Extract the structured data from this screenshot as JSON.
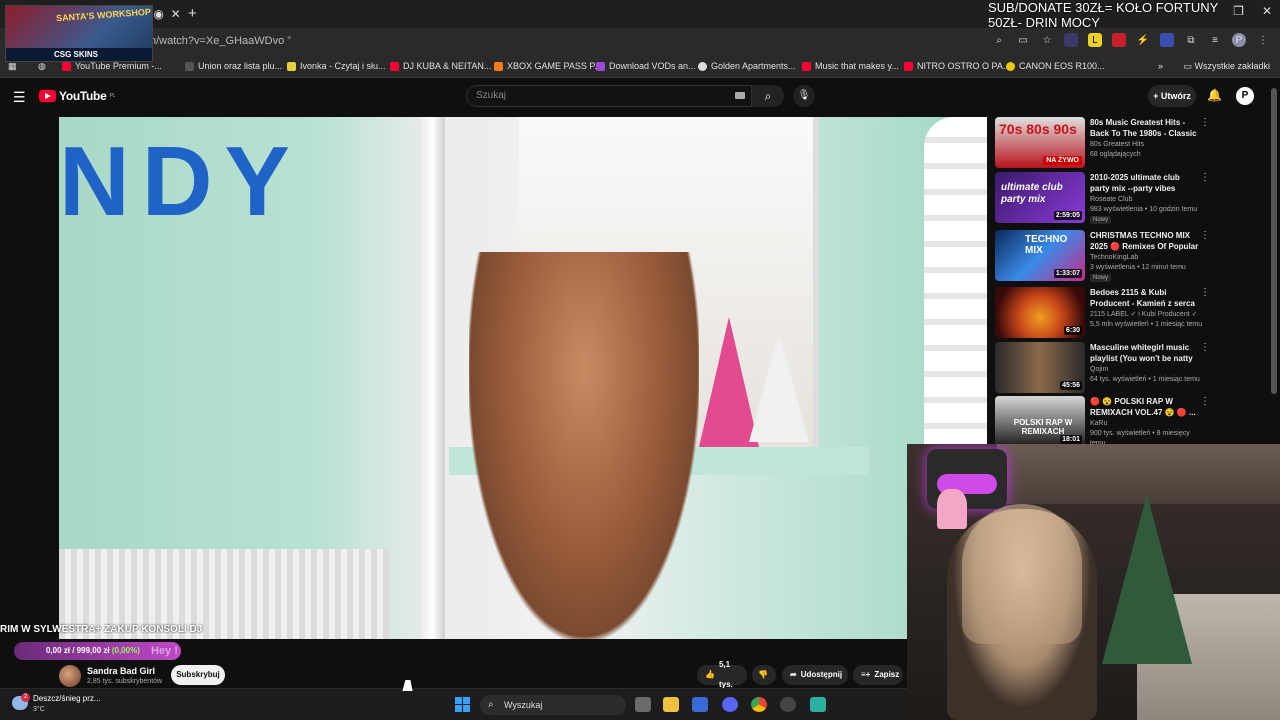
{
  "browser": {
    "url": "n/watch?v=Xe_GHaaWDvo",
    "bookmarks": [
      {
        "label": "YouTube Premium -...",
        "color": "#ff0033"
      },
      {
        "label": "Union oraz lista plu...",
        "color": "#555555"
      },
      {
        "label": "Ivonka - Czytaj i słu...",
        "color": "#e8d23c"
      },
      {
        "label": "DJ KUBA & NEITAN...",
        "color": "#ff0033"
      },
      {
        "label": "XBOX GAME PASS P...",
        "color": "#ff7a1a"
      },
      {
        "label": "Download VODs an...",
        "color": "#9b4ad8"
      },
      {
        "label": "Golden Apartments...",
        "color": "#dddddd"
      },
      {
        "label": "Music that makes y...",
        "color": "#ff0033"
      },
      {
        "label": "NITRO OSTRO O PA...",
        "color": "#ff0033"
      },
      {
        "label": "CANON EOS R100...",
        "color": "#f0c800"
      }
    ],
    "all_bookmarks_label": "Wszystkie zakładki",
    "profile_initial": "P"
  },
  "overlay": {
    "donate_line1": "SUB/DONATE 30ZŁ= KOŁO FORTUNY",
    "donate_line2": "50ZŁ- DRIN MOCY",
    "logo_top": "SANTA'S WORKSHOP",
    "logo_bottom": "CSG SKINS",
    "ticker": "RIM W SYLWESTRA+ ZAKUP KONSOLI DJ",
    "donation_text": "0,00 zł / 999,00 zł",
    "donation_pct": "(0,00%)",
    "donation_hey": "Hey !"
  },
  "youtube": {
    "logo": "YouTube",
    "logo_region": "PL",
    "search_placeholder": "Szukaj",
    "create_label": "Utwórz",
    "avatar_initial": "P",
    "video_overlay_text": "NDY",
    "channel_name": "Sandra Bad Girl",
    "channel_subs": "2,85 tys. subskrybentów",
    "subscribe_label": "Subskrybuj",
    "likes": "5,1 tys.",
    "share_label": "Udostępnij",
    "save_label": "Zapisz"
  },
  "recommendations": [
    {
      "title": "80s Music Greatest Hits - Back To The 1980s - Classic Music ...",
      "channel": "80s Greatest Hits",
      "meta": "68 oglądających",
      "badge": "",
      "duration": "",
      "live": "NA ŻYWO",
      "thumb_text": "70s 80s 90s",
      "thumb_color": "#b8141c"
    },
    {
      "title": "2010-2025 ultimate club party mix --party vibes playlist",
      "channel": "Roseate Club",
      "meta": "983 wyświetlenia • 10 godzin temu",
      "badge": "Nowy",
      "duration": "2:59:05",
      "live": "",
      "thumb_text": "ultimate club party mix",
      "thumb_color": "#6a2aa8"
    },
    {
      "title": "CHRISTMAS TECHNO MIX 2025 🔴 Remixes Of Popular Songs...",
      "channel": "TechnoKingLab",
      "meta": "3 wyświetlenia • 12 minut temu",
      "badge": "Nowy",
      "duration": "1:33:07",
      "live": "",
      "thumb_text": "TECHNO MIX",
      "thumb_color": "#2a6ad8"
    },
    {
      "title": "Bedoes 2115 & Kubi Producent - Kamień z serca",
      "channel": "2115 LABEL ✓ i Kubi Producent ✓",
      "meta": "5,5 mln wyświetleń • 1 miesiąc temu",
      "badge": "",
      "duration": "6:30",
      "live": "",
      "thumb_text": "",
      "thumb_color": "#c8461a"
    },
    {
      "title": "Masculine whitegirl music playlist (You won't be natty aft...",
      "channel": "Qojim",
      "meta": "64 tys. wyświetleń • 1 miesiąc temu",
      "badge": "",
      "duration": "45:56",
      "live": "",
      "thumb_text": "",
      "thumb_color": "#6b4a34"
    },
    {
      "title": "🔴 😵 POLSKI RAP W REMIXACH VOL.47 😵 🔴 ...",
      "channel": "KaRu",
      "meta": "900 tys. wyświetleń • 8 miesięcy temu",
      "badge": "",
      "duration": "18:01",
      "live": "",
      "thumb_text": "POLSKI RAP W REMIXACH",
      "thumb_color": "#1a1a1a"
    }
  ],
  "taskbar": {
    "weather": "Deszcz/śnieg prz...",
    "temp": "3°C",
    "weather_badge": "2",
    "search_label": "Wyszukaj"
  }
}
